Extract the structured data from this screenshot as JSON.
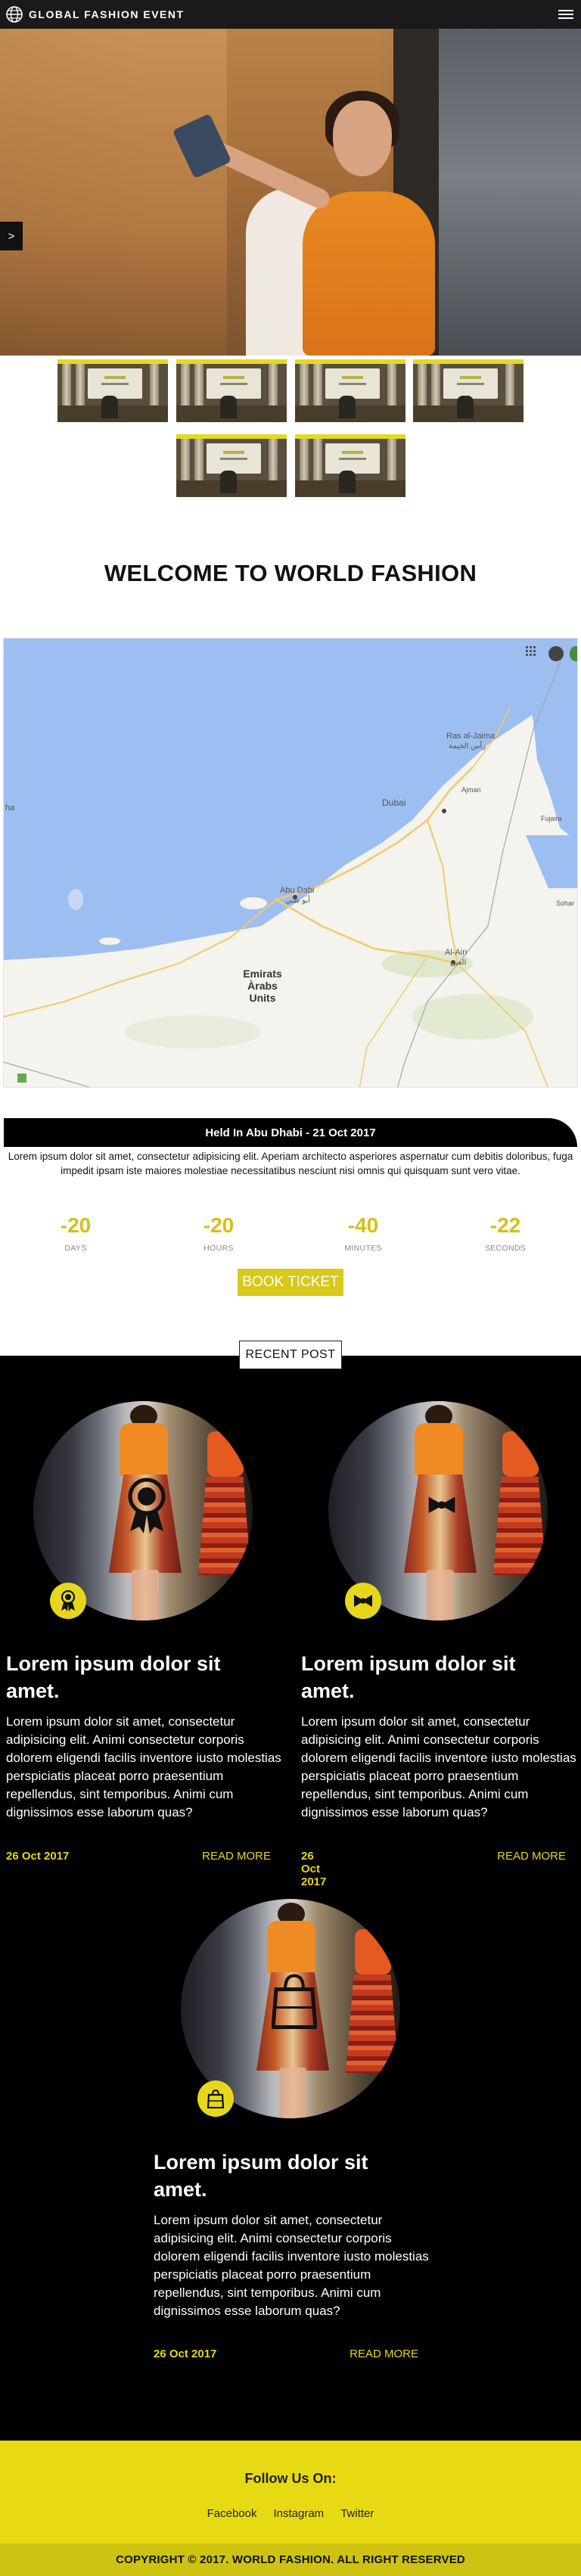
{
  "navbar": {
    "brand": "GLOBAL FASHION EVENT",
    "menu_icon": "hamburger-menu-icon",
    "logo_icon": "globe-icon"
  },
  "hero": {
    "arrow_label": ">"
  },
  "welcome": {
    "heading": "WELCOME TO WORLD FASHION"
  },
  "map": {
    "labels": {
      "dubai": "Dubai",
      "ras_al_jaima": "Ras al-Jaima",
      "ras_ar": "رأس الخيمة",
      "ajman": "Ajman",
      "fujaira": "Fujaira",
      "sohar": "Sohar",
      "abu_dhabi": "Abu Dabi",
      "abu_dhabi_ar": "أبو ظبي",
      "al_ain": "Al-Ain",
      "al_ain_ar": "العين",
      "emirates_1": "Emirats",
      "emirates_2": "Àrabs",
      "emirates_3": "Units",
      "ha": "ha"
    }
  },
  "event": {
    "held": "Held In Abu Dhabi - 21 Oct 2017",
    "description": "Lorem ipsum dolor sit amet, consectetur adipisicing elit. Aperiam architecto asperiores aspernatur cum debitis doloribus, fuga impedit ipsam iste maiores molestiae necessitatibus nesciunt nisi omnis qui quisquam sunt vero vitae."
  },
  "countdown": [
    {
      "value": "-20",
      "label": "DAYS"
    },
    {
      "value": "-20",
      "label": "HOURS"
    },
    {
      "value": "-40",
      "label": "MINUTES"
    },
    {
      "value": "-22",
      "label": "SECONDS"
    }
  ],
  "book_button": "BOOK TICKET",
  "recent": {
    "title": "RECENT POST",
    "posts": [
      {
        "title": "Lorem ipsum dolor sit amet.",
        "text": "Lorem ipsum dolor sit amet, consectetur adipisicing elit. Animi consectetur corporis dolorem eligendi facilis inventore iusto molestias perspiciatis placeat porro praesentium repellendus, sint temporibus. Animi cum dignissimos esse laborum quas?",
        "date": "26 Oct 2017",
        "more": "READ MORE",
        "icon": "medal-icon"
      },
      {
        "title": "Lorem ipsum dolor sit amet.",
        "text": "Lorem ipsum dolor sit amet, consectetur adipisicing elit. Animi consectetur corporis dolorem eligendi facilis inventore iusto molestias perspiciatis placeat porro praesentium repellendus, sint temporibus. Animi cum dignissimos esse laborum quas?",
        "date": "26 Oct 2017",
        "more": "READ MORE",
        "icon": "bow-tie-icon"
      },
      {
        "title": "Lorem ipsum dolor sit amet.",
        "text": "Lorem ipsum dolor sit amet, consectetur adipisicing elit. Animi consectetur corporis dolorem eligendi facilis inventore iusto molestias perspiciatis placeat porro praesentium repellendus, sint temporibus. Animi cum dignissimos esse laborum quas?",
        "date": "26 Oct 2017",
        "more": "READ MORE",
        "icon": "shopping-bag-icon"
      }
    ]
  },
  "footer": {
    "follow": "Follow Us On:",
    "links": [
      "Facebook",
      "Instagram",
      "Twitter"
    ],
    "copyright": "COPYRIGHT © 2017. WORLD FASHION. ALL RIGHT RESERVED"
  },
  "colors": {
    "accent_yellow": "#e6d71c",
    "dark": "#000000",
    "navbar": "#1a1a1a"
  }
}
